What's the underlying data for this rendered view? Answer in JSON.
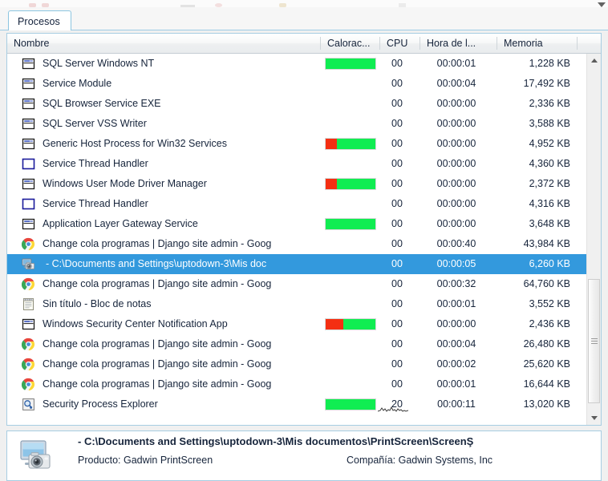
{
  "window": {
    "tab_label": "Procesos"
  },
  "columns": [
    {
      "key": "name",
      "label": "Nombre"
    },
    {
      "key": "graph",
      "label": "Calorac..."
    },
    {
      "key": "cpu",
      "label": "CPU"
    },
    {
      "key": "time",
      "label": "Hora de l..."
    },
    {
      "key": "memory",
      "label": "Memoria"
    }
  ],
  "rows": [
    {
      "icon": "window-icon",
      "name": "SQL Server Windows NT",
      "bar": {
        "red": 0,
        "green": 100
      },
      "cpu": "00",
      "time": "00:00:01",
      "memory": "1,228 KB",
      "selected": false
    },
    {
      "icon": "window-icon",
      "name": "Service Module",
      "bar": null,
      "cpu": "00",
      "time": "00:00:04",
      "memory": "17,492 KB",
      "selected": false
    },
    {
      "icon": "window-icon",
      "name": "SQL Browser Service EXE",
      "bar": null,
      "cpu": "00",
      "time": "00:00:00",
      "memory": "2,336 KB",
      "selected": false
    },
    {
      "icon": "window-icon",
      "name": "SQL Server VSS Writer",
      "bar": null,
      "cpu": "00",
      "time": "00:00:00",
      "memory": "3,588 KB",
      "selected": false
    },
    {
      "icon": "window-icon",
      "name": "Generic Host Process for Win32 Services",
      "bar": {
        "red": 22,
        "green": 78
      },
      "cpu": "00",
      "time": "00:00:00",
      "memory": "4,952 KB",
      "selected": false
    },
    {
      "icon": "window-blue-icon",
      "name": "Service Thread Handler",
      "bar": null,
      "cpu": "00",
      "time": "00:00:00",
      "memory": "4,360 KB",
      "selected": false
    },
    {
      "icon": "window-icon",
      "name": "Windows User Mode Driver Manager",
      "bar": {
        "red": 22,
        "green": 78
      },
      "cpu": "00",
      "time": "00:00:00",
      "memory": "2,372 KB",
      "selected": false
    },
    {
      "icon": "window-blue-icon",
      "name": "Service Thread Handler",
      "bar": null,
      "cpu": "00",
      "time": "00:00:00",
      "memory": "4,316 KB",
      "selected": false
    },
    {
      "icon": "window-icon",
      "name": "Application Layer Gateway Service",
      "bar": {
        "red": 0,
        "green": 100
      },
      "cpu": "00",
      "time": "00:00:00",
      "memory": "3,648 KB",
      "selected": false
    },
    {
      "icon": "chrome-icon",
      "name": "Change cola programas | Django site admin - Goog",
      "bar": null,
      "cpu": "00",
      "time": "00:00:40",
      "memory": "43,984 KB",
      "selected": false
    },
    {
      "icon": "printscreen-icon",
      "name": " - C:\\Documents and Settings\\uptodown-3\\Mis doc",
      "bar": null,
      "cpu": "00",
      "time": "00:00:05",
      "memory": "6,260 KB",
      "selected": true
    },
    {
      "icon": "chrome-icon",
      "name": "Change cola programas | Django site admin - Goog",
      "bar": null,
      "cpu": "00",
      "time": "00:00:32",
      "memory": "64,760 KB",
      "selected": false
    },
    {
      "icon": "notepad-icon",
      "name": "Sin título - Bloc de notas",
      "bar": null,
      "cpu": "00",
      "time": "00:00:01",
      "memory": "3,552 KB",
      "selected": false
    },
    {
      "icon": "window-icon",
      "name": "Windows Security Center Notification App",
      "bar": {
        "red": 35,
        "green": 65
      },
      "cpu": "00",
      "time": "00:00:00",
      "memory": "2,436 KB",
      "selected": false
    },
    {
      "icon": "chrome-icon",
      "name": "Change cola programas | Django site admin - Goog",
      "bar": null,
      "cpu": "00",
      "time": "00:00:04",
      "memory": "26,480 KB",
      "selected": false
    },
    {
      "icon": "chrome-icon",
      "name": "Change cola programas | Django site admin - Goog",
      "bar": null,
      "cpu": "00",
      "time": "00:00:02",
      "memory": "25,620 KB",
      "selected": false
    },
    {
      "icon": "chrome-icon",
      "name": "Change cola programas | Django site admin - Goog",
      "bar": null,
      "cpu": "00",
      "time": "00:00:01",
      "memory": "16,644 KB",
      "selected": false
    },
    {
      "icon": "magnifier-icon",
      "name": "Security Process Explorer",
      "bar": {
        "red": 0,
        "green": 100
      },
      "cpu": "20",
      "time": "00:00:11",
      "memory": "13,020 KB",
      "selected": false
    }
  ],
  "details": {
    "icon": "printscreen-large-icon",
    "title": " - C:\\Documents and Settings\\uptodown-3\\Mis documentos\\PrintScreen\\ScreenŞ",
    "product_label": "Producto: Gadwin PrintScreen",
    "company_label": "Compañía: Gadwin Systems, Inc"
  },
  "colors": {
    "selection": "#3399dd",
    "bar_green": "#10ed52",
    "bar_red": "#f42f12",
    "panel_border": "#a7cde2",
    "text": "#16243b"
  }
}
